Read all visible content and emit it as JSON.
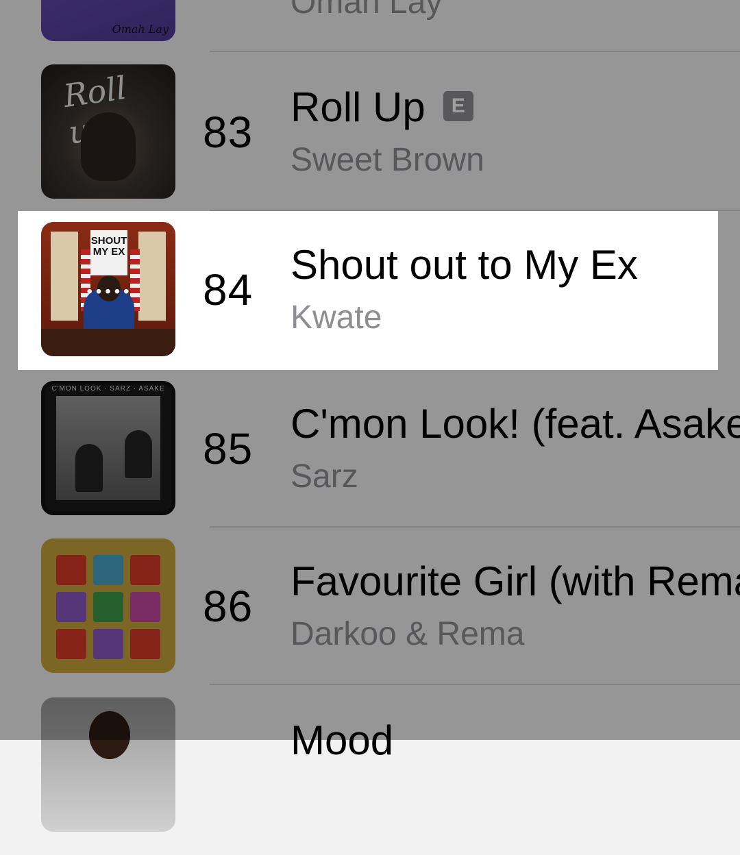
{
  "rows": [
    {
      "rank": "",
      "title": "",
      "artist": "Omah Lay",
      "explicit": false,
      "art_text": "Omah Lay"
    },
    {
      "rank": "83",
      "title": "Roll Up",
      "artist": "Sweet Brown",
      "explicit": true,
      "explicit_label": "E",
      "art_text": "Roll up"
    },
    {
      "rank": "84",
      "title": "Shout out to My Ex",
      "artist": "Kwate",
      "explicit": false,
      "art_text": "SHOUT MY EX"
    },
    {
      "rank": "85",
      "title": "C'mon Look! (feat. Asake)",
      "artist": "Sarz",
      "explicit": false,
      "art_text": "C'MON LOOK · SARZ · ASAKE"
    },
    {
      "rank": "86",
      "title": "Favourite Girl (with Rema)",
      "artist": "Darkoo & Rema",
      "explicit": false
    },
    {
      "rank": "",
      "title": "Mood",
      "artist": "",
      "explicit": false
    }
  ],
  "colors": {
    "background": "#f2f2f2",
    "title": "#000000",
    "artist": "#8e8e93",
    "explicit_badge": "#8e8e93",
    "dim_overlay": "rgba(0,0,0,0.38)",
    "highlight": "#ffffff"
  }
}
